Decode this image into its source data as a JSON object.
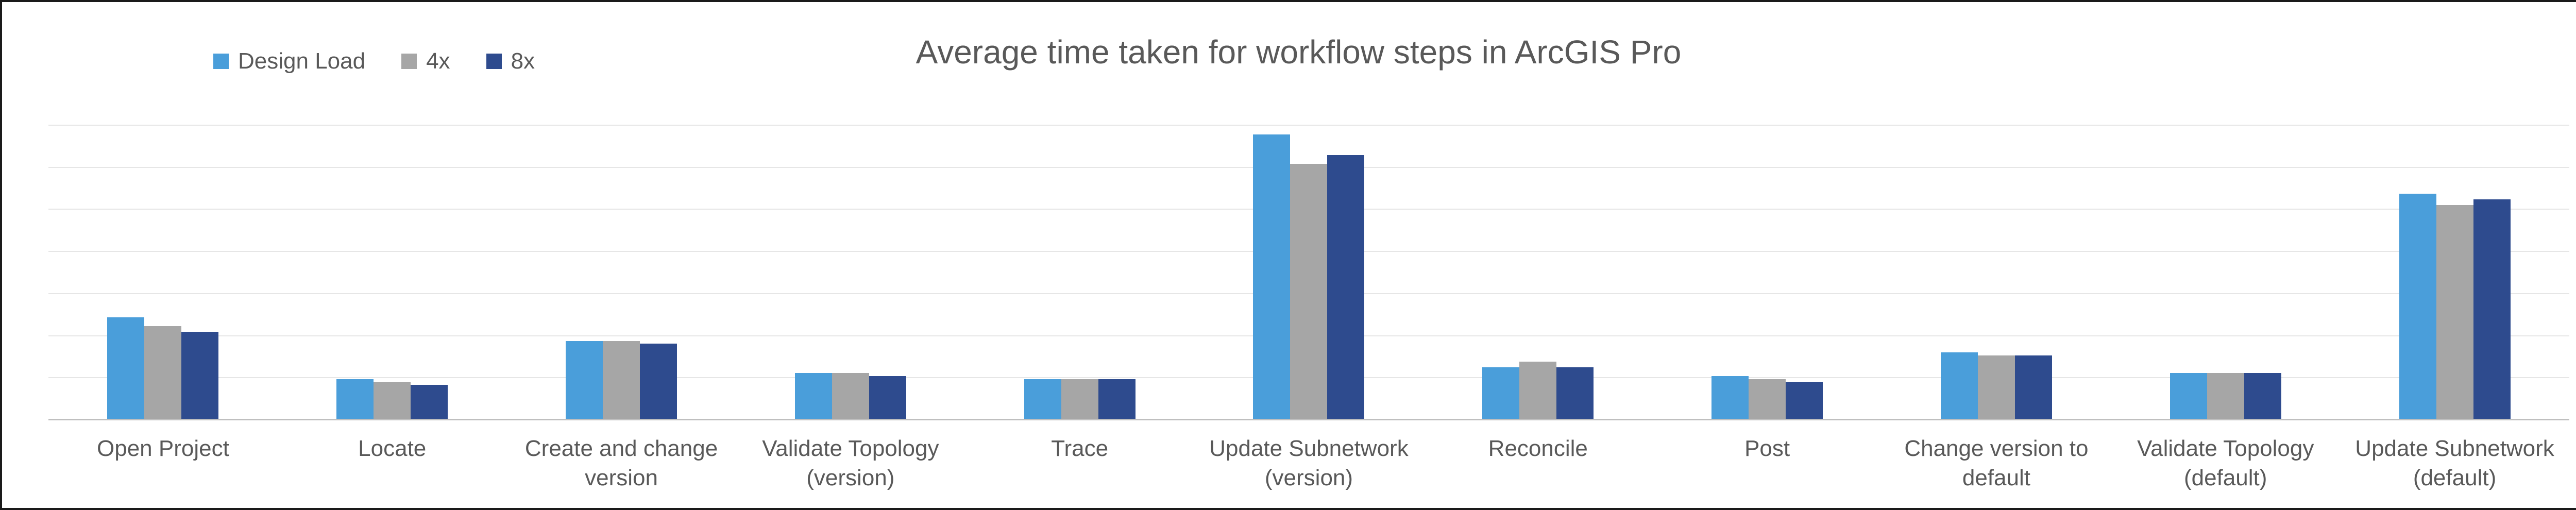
{
  "chart_data": {
    "type": "bar",
    "title": "Average time taken for workflow steps in ArcGIS Pro",
    "xlabel": "",
    "ylabel": "",
    "ylim": [
      0,
      100
    ],
    "legend_position": "top-left",
    "grid": true,
    "categories": [
      "Open Project",
      "Locate",
      "Create and change version",
      "Validate Topology (version)",
      "Trace",
      "Update Subnetwork (version)",
      "Reconcile",
      "Post",
      "Change version to default",
      "Validate Topology (default)",
      "Update Subnetwork (default)"
    ],
    "series": [
      {
        "name": "Design Load",
        "color": "#4a9eda",
        "values": [
          35,
          14,
          27,
          16,
          14,
          97,
          18,
          15,
          23,
          16,
          77
        ]
      },
      {
        "name": "4x",
        "color": "#a6a6a6",
        "values": [
          32,
          13,
          27,
          16,
          14,
          87,
          20,
          14,
          22,
          16,
          73
        ]
      },
      {
        "name": "8x",
        "color": "#2e4b8e",
        "values": [
          30,
          12,
          26,
          15,
          14,
          90,
          18,
          13,
          22,
          16,
          75
        ]
      }
    ]
  }
}
